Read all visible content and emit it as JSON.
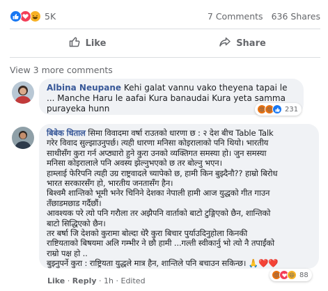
{
  "post_stats": {
    "reaction_count": "5K",
    "comments": "7 Comments",
    "shares": "636 Shares",
    "reaction_icons": [
      "like-icon",
      "love-icon",
      "haha-icon"
    ]
  },
  "actions": {
    "like_label": "Like",
    "share_label": "Share"
  },
  "view_more": "View 3 more comments",
  "comments": [
    {
      "author": "Albina Neupane",
      "text": "Kehi galat vannu vako theyena tapai le ... Manche Haru le aafai Kura banaudai Kura yeta samma purayeka hunn",
      "reaction_count": "231",
      "reaction_icons": [
        "angry-icon",
        "angry-icon",
        "like-icon"
      ]
    },
    {
      "author": "बिबेक धिताल",
      "lines": [
        "सिमा विवादमा वर्षा राउतको धारणा छ : २ देश बीच Table Talk",
        "गरेर विवाद सुल्झाउनुपर्छ। त्यही धारणा मनिसा कोइरालाको पनि थियो। भारतीय",
        "साथीसँग कुरा गर्न अप्ठ्यारो हुने कुरा उनको व्यक्तिगत समस्या हो। जुन समस्या",
        "मनिसा कोइरालाले पनि अवस्य झेल्नुभएको छ तर बोल्नु भएन।",
        "हाम्लाई फेरिपनि त्यही उग्र राष्ट्रवादले च्यापेको छ, हामी किन बुझ्दैनौ?? हाम्रो बिरोध",
        "भारत सरकारसँग हो, भारतीय जनतासँग हैन।",
        "बिश्वमै शान्तिको भूमी भनेर चिनिने देशका नेपाली हामी आज युद्धको गीत गाउन",
        "तँछाडमछाड गर्दैछौं।",
        "आवश्यक परे त्यो पनि गरौला तर अझैपनि वार्ताको बाटो टुङ्गिएको छैन, शान्तिको",
        "बाटो सिद्धिएको छैन।",
        "तर बर्षा जि देशको कुरामा बोल्दा धेरै कुरा बिचार पुर्याउदिनुहोला किनकी",
        "राष्टियताको बिषयमा अलि गम्भीर ने छौ हामी ...गल्ती स्वीकार्नु भो त्यो नै तपाईंको",
        "राम्रो पक्ष हो ..",
        "बुझ्नुपर्ने कुरा : राष्ट्रियता युद्धले मात्र हैन, शान्तिले पनि बचाउन सकिन्छ।"
      ],
      "trail": "🙏❤️❤️",
      "reaction_count": "88",
      "reaction_icons": [
        "angry-icon",
        "love-icon",
        "haha-icon"
      ],
      "meta": {
        "like": "Like",
        "reply": "Reply",
        "time": "1h",
        "edited": "Edited"
      }
    }
  ],
  "colors": {
    "brand_blue": "#1877f2",
    "author_blue": "#385898",
    "bubble_gray": "#f0f2f5",
    "secondary_text": "#65676b"
  }
}
